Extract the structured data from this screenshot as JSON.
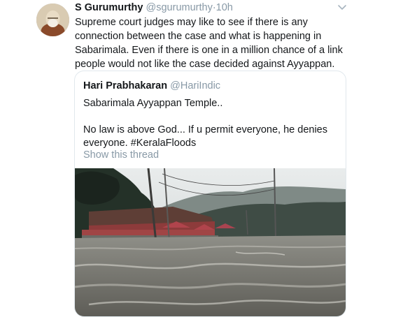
{
  "tweet": {
    "author_name": "S Gurumurthy",
    "author_handle": "@sgurumurthy",
    "separator": "·",
    "time": "10h",
    "body_lines": [
      "Supreme court judges may like to see if there is any",
      "connection between the case and what is happening in",
      "Sabarimala. Even if there is one in a million chance of a link",
      "people would not like the case decided against Ayyappan."
    ]
  },
  "quoted": {
    "author_name": "Hari Prabhakaran",
    "author_handle": "@HariIndic",
    "line1": "Sabarimala Ayyappan Temple..",
    "line2": "No law is above God... If u permit everyone, he denies",
    "line3": "everyone. #KeralaFloods",
    "show_thread": "Show this thread"
  },
  "icons": {
    "more": "chevron-down-icon"
  },
  "colors": {
    "text": "#14171a",
    "muted": "#8899a6",
    "border": "#e1e8ed"
  }
}
